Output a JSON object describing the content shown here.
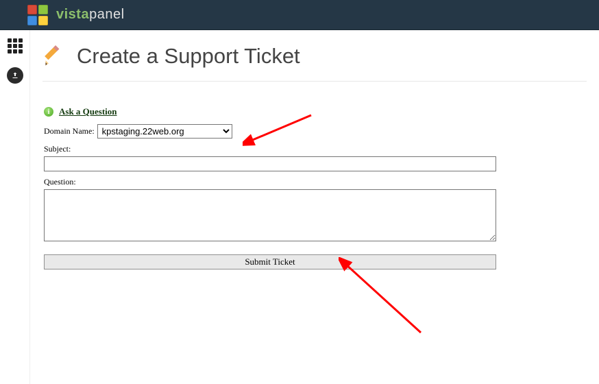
{
  "brand": {
    "green": "vista",
    "rest": "panel"
  },
  "page": {
    "title": "Create a Support Ticket"
  },
  "form": {
    "ask_link": "Ask a Question",
    "domain_label": "Domain Name:",
    "domain_selected": "kpstaging.22web.org",
    "subject_label": "Subject:",
    "question_label": "Question:",
    "submit_label": "Submit Ticket"
  },
  "icons": {
    "apps": "apps-icon",
    "upload": "upload-icon",
    "pencil": "pencil-icon",
    "info": "info-icon"
  }
}
